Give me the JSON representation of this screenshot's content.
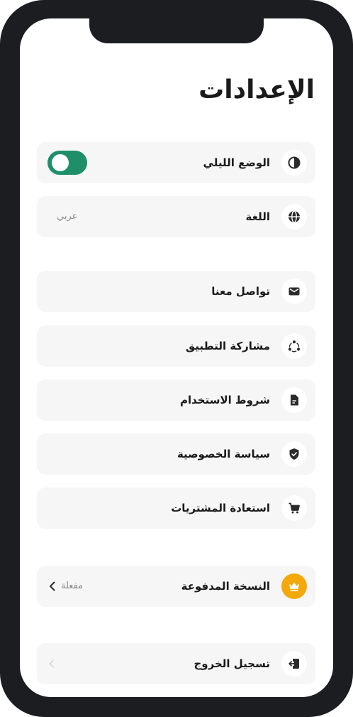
{
  "page": {
    "title": "الإعدادات"
  },
  "colors": {
    "toggle_on": "#1f8f6a",
    "premium": "#f4a80b",
    "row_bg": "#f6f6f6"
  },
  "rows": {
    "night_mode": {
      "label": "الوضع الليلي",
      "icon": "contrast-icon",
      "toggle_on": true
    },
    "language": {
      "label": "اللغة",
      "value": "عربي",
      "icon": "globe-icon"
    },
    "contact": {
      "label": "تواصل معنا",
      "icon": "mail-icon"
    },
    "share": {
      "label": "مشاركة التطبيق",
      "icon": "share-icon"
    },
    "terms": {
      "label": "شروط الاستخدام",
      "icon": "document-icon"
    },
    "privacy": {
      "label": "سياسة الخصوصية",
      "icon": "shield-check-icon"
    },
    "restore": {
      "label": "استعادة المشتريات",
      "icon": "cart-icon"
    },
    "premium": {
      "label": "النسخة المدفوعة",
      "value": "مفعلة",
      "icon": "crown-icon"
    },
    "logout": {
      "label": "تسجيل الخروج",
      "icon": "logout-icon"
    }
  }
}
